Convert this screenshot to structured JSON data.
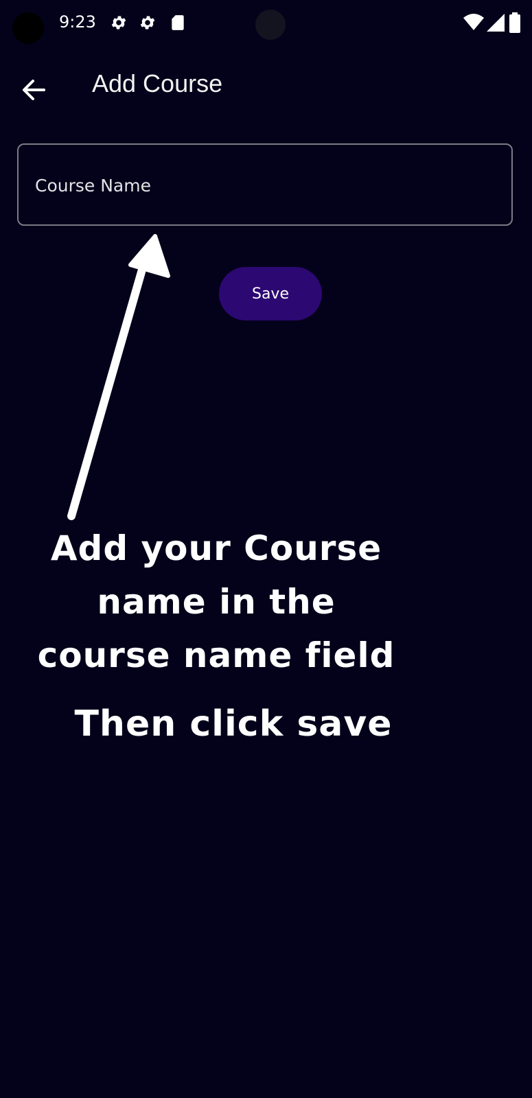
{
  "status_bar": {
    "time": "9:23",
    "left_icons": [
      "gear-icon",
      "gear-icon",
      "sd-card-icon"
    ],
    "right_icons": [
      "wifi-icon",
      "cellular-signal-icon",
      "battery-icon"
    ]
  },
  "app_bar": {
    "back_icon": "arrow-left-icon",
    "title": "Add Course"
  },
  "form": {
    "course_name_placeholder": "Course Name",
    "course_name_value": "",
    "save_label": "Save"
  },
  "annotation": {
    "instruction_lines": [
      "Add your Course",
      "name in the",
      "course name field"
    ],
    "followup": "Then click save"
  },
  "colors": {
    "background": "#04021a",
    "accent": "#2c0873",
    "field_border": "#7b7b86",
    "text": "#ffffff"
  }
}
